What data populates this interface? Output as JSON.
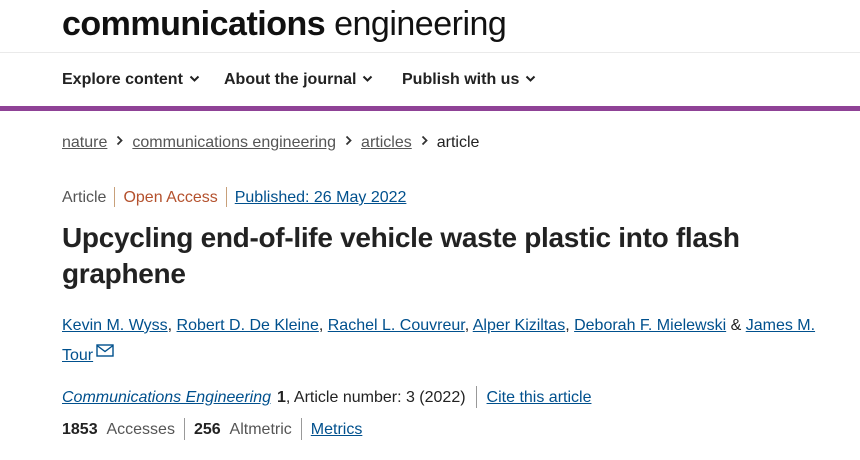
{
  "header": {
    "logo_bold": "communications",
    "logo_light": " engineering"
  },
  "nav": {
    "items": [
      {
        "label": "Explore content"
      },
      {
        "label": "About the journal"
      },
      {
        "label": "Publish with us"
      }
    ]
  },
  "colors": {
    "accent_bar": "#8f4296",
    "link": "#00508d",
    "open_access": "#b4512d"
  },
  "breadcrumb": {
    "items": [
      "nature",
      "communications engineering",
      "articles"
    ],
    "current": "article"
  },
  "article_meta": {
    "type": "Article",
    "access": "Open Access",
    "published": "Published: 26 May 2022"
  },
  "article": {
    "title": "Upcycling end-of-life vehicle waste plastic into flash graphene",
    "authors": [
      "Kevin M. Wyss",
      "Robert D. De Kleine",
      "Rachel L. Couvreur",
      "Alper Kiziltas",
      "Deborah F. Mielewski",
      "James M. Tour"
    ],
    "author_separator": ", ",
    "last_author_joiner": " & ",
    "corresponding_icon": "mail-icon"
  },
  "journal": {
    "name": "Communications Engineering",
    "volume": "1",
    "article_number_text": ", Article number: 3 (2022)",
    "cite_label": "Cite this article"
  },
  "metrics": {
    "accesses_value": "1853",
    "accesses_label": "Accesses",
    "altmetric_value": "256",
    "altmetric_label": "Altmetric",
    "metrics_link": "Metrics"
  }
}
